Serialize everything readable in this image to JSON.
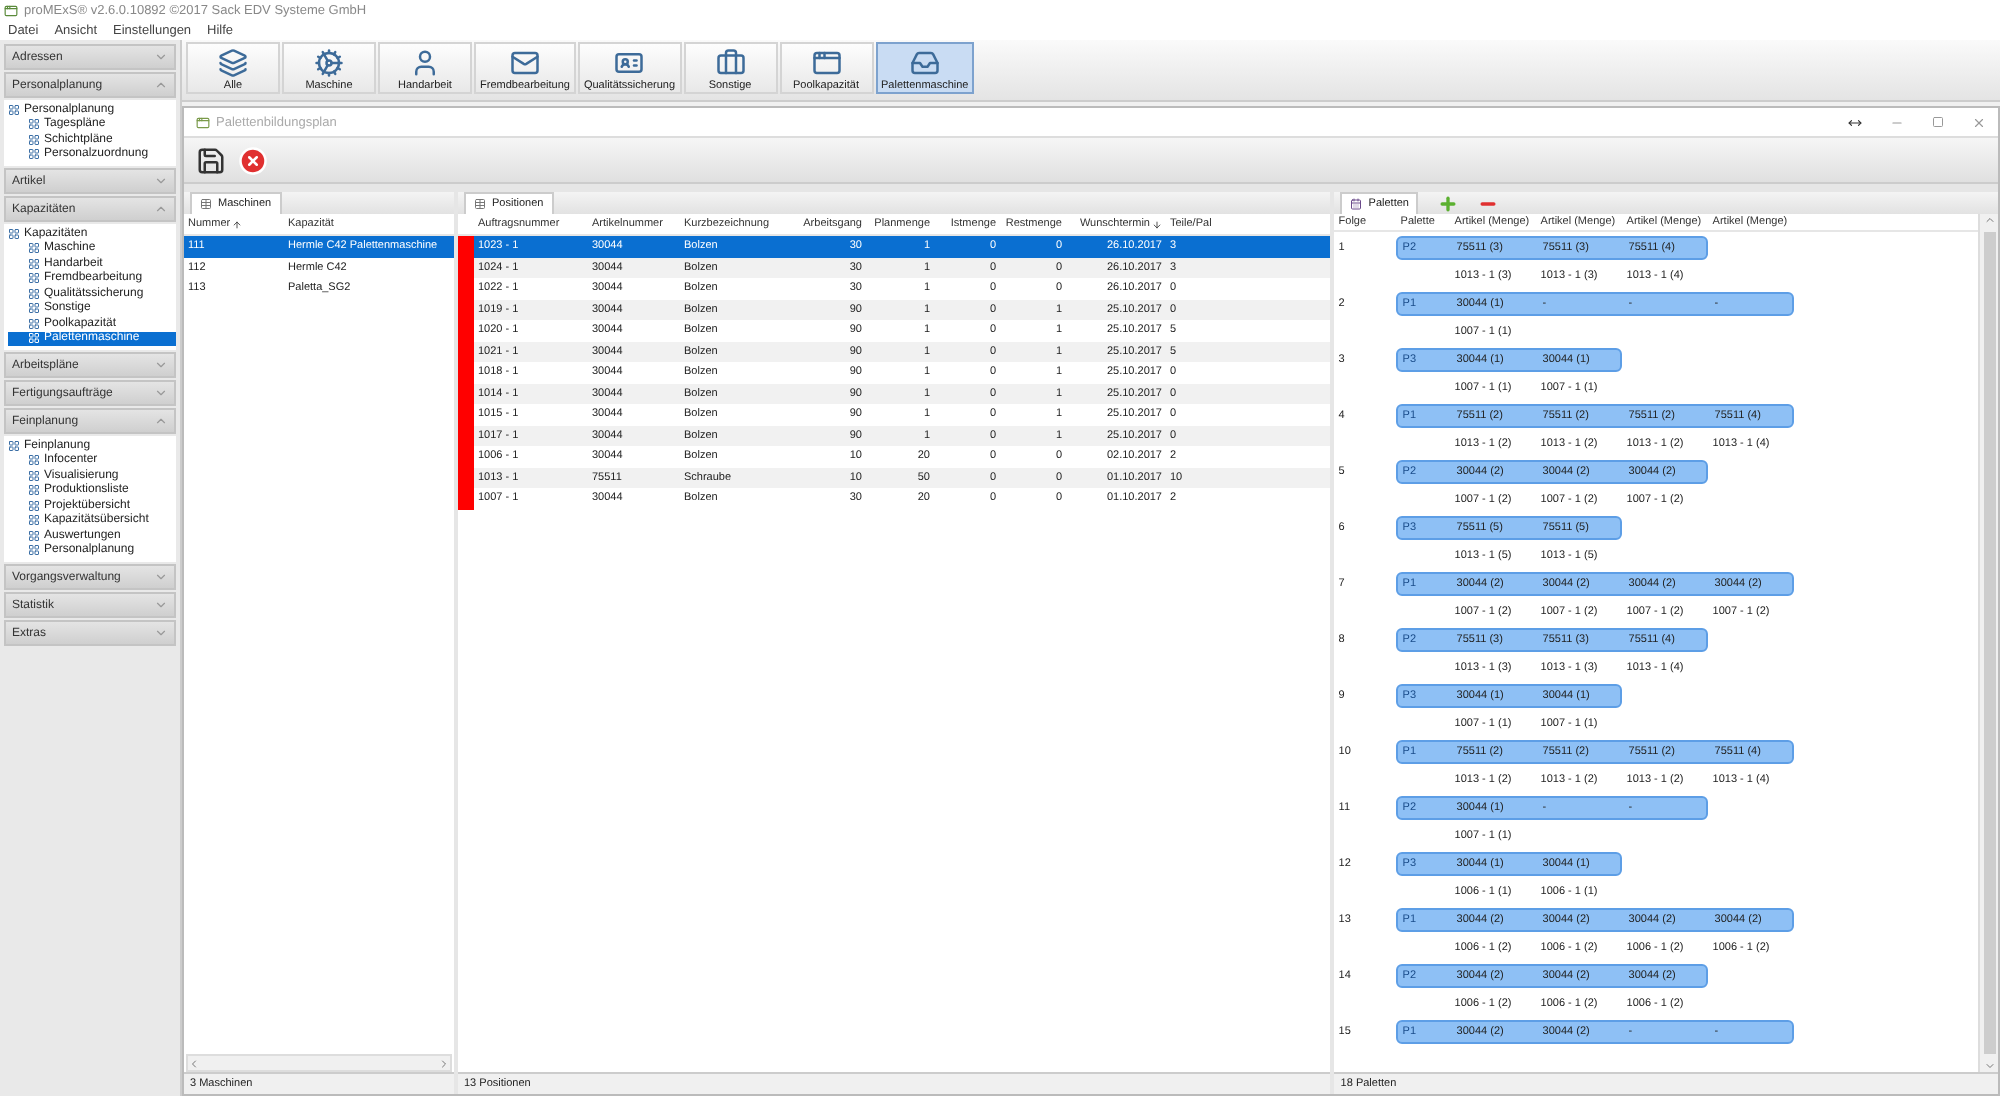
{
  "window": {
    "title": "proMExS® v2.6.0.10892 ©2017 Sack EDV Systeme GmbH"
  },
  "menu": [
    "Datei",
    "Ansicht",
    "Einstellungen",
    "Hilfe"
  ],
  "sidebar": [
    {
      "title": "Adressen",
      "expanded": false
    },
    {
      "title": "Personalplanung",
      "expanded": true,
      "tree": [
        {
          "label": "Personalplanung",
          "selected": false,
          "children": [
            {
              "label": "Tagespläne",
              "selected": false
            },
            {
              "label": "Schichtpläne",
              "selected": false
            },
            {
              "label": "Personalzuordnung",
              "selected": false
            }
          ]
        }
      ]
    },
    {
      "title": "Artikel",
      "expanded": false
    },
    {
      "title": "Kapazitäten",
      "expanded": true,
      "tree": [
        {
          "label": "Kapazitäten",
          "selected": false,
          "children": [
            {
              "label": "Maschine",
              "selected": false
            },
            {
              "label": "Handarbeit",
              "selected": false
            },
            {
              "label": "Fremdbearbeitung",
              "selected": false
            },
            {
              "label": "Qualitätssicherung",
              "selected": false
            },
            {
              "label": "Sonstige",
              "selected": false
            },
            {
              "label": "Poolkapazität",
              "selected": false
            },
            {
              "label": "Palettenmaschine",
              "selected": true
            }
          ]
        }
      ]
    },
    {
      "title": "Arbeitspläne",
      "expanded": false
    },
    {
      "title": "Fertigungsaufträge",
      "expanded": false
    },
    {
      "title": "Feinplanung",
      "expanded": true,
      "tree": [
        {
          "label": "Feinplanung",
          "selected": false,
          "children": [
            {
              "label": "Infocenter",
              "selected": false
            },
            {
              "label": "Visualisierung",
              "selected": false
            },
            {
              "label": "Produktionsliste",
              "selected": false
            },
            {
              "label": "Projektübersicht",
              "selected": false
            },
            {
              "label": "Kapazitätsübersicht",
              "selected": false
            },
            {
              "label": "Auswertungen",
              "selected": false
            },
            {
              "label": "Personalplanung",
              "selected": false
            }
          ]
        }
      ]
    },
    {
      "title": "Vorgangsverwaltung",
      "expanded": false
    },
    {
      "title": "Statistik",
      "expanded": false
    },
    {
      "title": "Extras",
      "expanded": false
    }
  ],
  "ribbon": [
    {
      "label": "Alle",
      "selected": false
    },
    {
      "label": "Maschine",
      "selected": false
    },
    {
      "label": "Handarbeit",
      "selected": false
    },
    {
      "label": "Fremdbearbeitung",
      "selected": false
    },
    {
      "label": "Qualitätssicherung",
      "selected": false
    },
    {
      "label": "Sonstige",
      "selected": false
    },
    {
      "label": "Poolkapazität",
      "selected": false
    },
    {
      "label": "Palettenmaschine",
      "selected": true
    }
  ],
  "child_window": {
    "title": "Palettenbildungsplan"
  },
  "machines": {
    "tab": "Maschinen",
    "columns": [
      "Nummer",
      "Kapazität"
    ],
    "rows": [
      {
        "cells": [
          "111",
          "Hermle C42 Palettenmaschine"
        ],
        "selected": true
      },
      {
        "cells": [
          "112",
          "Hermle C42"
        ],
        "selected": false
      },
      {
        "cells": [
          "113",
          "Paletta_SG2"
        ],
        "selected": false
      }
    ],
    "status": "3 Maschinen"
  },
  "positions": {
    "tab": "Positionen",
    "columns": [
      "Auftragsnummer",
      "Artikelnummer",
      "Kurzbezeichnung",
      "Arbeitsgang",
      "Planmenge",
      "Istmenge",
      "Restmenge",
      "Wunschtermin",
      "Teile/Pal"
    ],
    "rows": [
      {
        "cells": [
          "1023 - 1",
          "30044",
          "Bolzen",
          "30",
          "1",
          "0",
          "0",
          "26.10.2017",
          "3"
        ],
        "selected": true,
        "color": "#ff0000"
      },
      {
        "cells": [
          "1024 - 1",
          "30044",
          "Bolzen",
          "30",
          "1",
          "0",
          "0",
          "26.10.2017",
          "3"
        ],
        "selected": false,
        "color": "#ff0000"
      },
      {
        "cells": [
          "1022 - 1",
          "30044",
          "Bolzen",
          "30",
          "1",
          "0",
          "0",
          "26.10.2017",
          "0"
        ],
        "selected": false,
        "color": "#ff0000"
      },
      {
        "cells": [
          "1019 - 1",
          "30044",
          "Bolzen",
          "90",
          "1",
          "0",
          "1",
          "25.10.2017",
          "0"
        ],
        "selected": false,
        "color": "#ff0000"
      },
      {
        "cells": [
          "1020 - 1",
          "30044",
          "Bolzen",
          "90",
          "1",
          "0",
          "1",
          "25.10.2017",
          "5"
        ],
        "selected": false,
        "color": "#ff0000"
      },
      {
        "cells": [
          "1021 - 1",
          "30044",
          "Bolzen",
          "90",
          "1",
          "0",
          "1",
          "25.10.2017",
          "5"
        ],
        "selected": false,
        "color": "#ff0000"
      },
      {
        "cells": [
          "1018 - 1",
          "30044",
          "Bolzen",
          "90",
          "1",
          "0",
          "1",
          "25.10.2017",
          "0"
        ],
        "selected": false,
        "color": "#ff0000"
      },
      {
        "cells": [
          "1014 - 1",
          "30044",
          "Bolzen",
          "90",
          "1",
          "0",
          "1",
          "25.10.2017",
          "0"
        ],
        "selected": false,
        "color": "#ff0000"
      },
      {
        "cells": [
          "1015 - 1",
          "30044",
          "Bolzen",
          "90",
          "1",
          "0",
          "1",
          "25.10.2017",
          "0"
        ],
        "selected": false,
        "color": "#ff0000"
      },
      {
        "cells": [
          "1017 - 1",
          "30044",
          "Bolzen",
          "90",
          "1",
          "0",
          "1",
          "25.10.2017",
          "0"
        ],
        "selected": false,
        "color": "#ff0000"
      },
      {
        "cells": [
          "1006 - 1",
          "30044",
          "Bolzen",
          "10",
          "20",
          "0",
          "0",
          "02.10.2017",
          "2"
        ],
        "selected": false,
        "color": "#ff0000"
      },
      {
        "cells": [
          "1013 - 1",
          "75511",
          "Schraube",
          "10",
          "50",
          "0",
          "0",
          "01.10.2017",
          "10"
        ],
        "selected": false,
        "color": "#ff0000"
      },
      {
        "cells": [
          "1007 - 1",
          "30044",
          "Bolzen",
          "30",
          "20",
          "0",
          "0",
          "01.10.2017",
          "2"
        ],
        "selected": false,
        "color": "#ff0000"
      }
    ],
    "status": "13 Positionen"
  },
  "pallets": {
    "tab": "Paletten",
    "columns": [
      "Folge",
      "Palette",
      "Artikel (Menge)",
      "Artikel (Menge)",
      "Artikel (Menge)",
      "Artikel (Menge)"
    ],
    "groups": [
      {
        "index": "1",
        "pallet": "P2",
        "articles": [
          "75511 (3)",
          "75511 (3)",
          "75511 (4)"
        ],
        "orders": [
          "1013 - 1 (3)",
          "1013 - 1 (3)",
          "1013 - 1 (4)"
        ]
      },
      {
        "index": "2",
        "pallet": "P1",
        "articles": [
          "30044 (1)",
          "-",
          "-",
          "-"
        ],
        "orders": [
          "1007 - 1 (1)"
        ]
      },
      {
        "index": "3",
        "pallet": "P3",
        "articles": [
          "30044 (1)",
          "30044 (1)"
        ],
        "orders": [
          "1007 - 1 (1)",
          "1007 - 1 (1)"
        ]
      },
      {
        "index": "4",
        "pallet": "P1",
        "articles": [
          "75511 (2)",
          "75511 (2)",
          "75511 (2)",
          "75511 (4)"
        ],
        "orders": [
          "1013 - 1 (2)",
          "1013 - 1 (2)",
          "1013 - 1 (2)",
          "1013 - 1 (4)"
        ]
      },
      {
        "index": "5",
        "pallet": "P2",
        "articles": [
          "30044 (2)",
          "30044 (2)",
          "30044 (2)"
        ],
        "orders": [
          "1007 - 1 (2)",
          "1007 - 1 (2)",
          "1007 - 1 (2)"
        ]
      },
      {
        "index": "6",
        "pallet": "P3",
        "articles": [
          "75511 (5)",
          "75511 (5)"
        ],
        "orders": [
          "1013 - 1 (5)",
          "1013 - 1 (5)"
        ]
      },
      {
        "index": "7",
        "pallet": "P1",
        "articles": [
          "30044 (2)",
          "30044 (2)",
          "30044 (2)",
          "30044 (2)"
        ],
        "orders": [
          "1007 - 1 (2)",
          "1007 - 1 (2)",
          "1007 - 1 (2)",
          "1007 - 1 (2)"
        ]
      },
      {
        "index": "8",
        "pallet": "P2",
        "articles": [
          "75511 (3)",
          "75511 (3)",
          "75511 (4)"
        ],
        "orders": [
          "1013 - 1 (3)",
          "1013 - 1 (3)",
          "1013 - 1 (4)"
        ]
      },
      {
        "index": "9",
        "pallet": "P3",
        "articles": [
          "30044 (1)",
          "30044 (1)"
        ],
        "orders": [
          "1007 - 1 (1)",
          "1007 - 1 (1)"
        ]
      },
      {
        "index": "10",
        "pallet": "P1",
        "articles": [
          "75511 (2)",
          "75511 (2)",
          "75511 (2)",
          "75511 (4)"
        ],
        "orders": [
          "1013 - 1 (2)",
          "1013 - 1 (2)",
          "1013 - 1 (2)",
          "1013 - 1 (4)"
        ]
      },
      {
        "index": "11",
        "pallet": "P2",
        "articles": [
          "30044 (1)",
          "-",
          "-"
        ],
        "orders": [
          "1007 - 1 (1)"
        ]
      },
      {
        "index": "12",
        "pallet": "P3",
        "articles": [
          "30044 (1)",
          "30044 (1)"
        ],
        "orders": [
          "1006 - 1 (1)",
          "1006 - 1 (1)"
        ]
      },
      {
        "index": "13",
        "pallet": "P1",
        "articles": [
          "30044 (2)",
          "30044 (2)",
          "30044 (2)",
          "30044 (2)"
        ],
        "orders": [
          "1006 - 1 (2)",
          "1006 - 1 (2)",
          "1006 - 1 (2)",
          "1006 - 1 (2)"
        ]
      },
      {
        "index": "14",
        "pallet": "P2",
        "articles": [
          "30044 (2)",
          "30044 (2)",
          "30044 (2)"
        ],
        "orders": [
          "1006 - 1 (2)",
          "1006 - 1 (2)",
          "1006 - 1 (2)"
        ]
      },
      {
        "index": "15",
        "pallet": "P1",
        "articles": [
          "30044 (2)",
          "30044 (2)",
          "-",
          "-"
        ]
      }
    ],
    "status": "18 Paletten"
  }
}
